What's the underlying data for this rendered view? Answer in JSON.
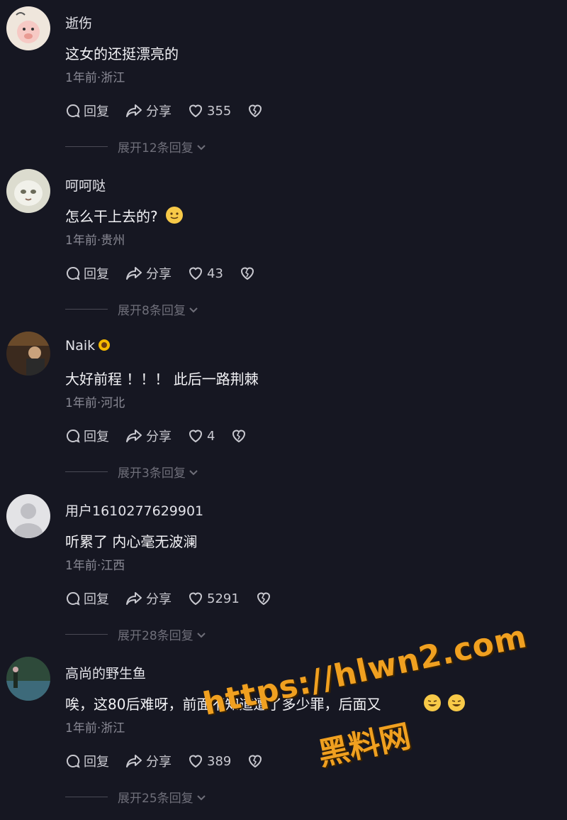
{
  "colors": {
    "background": "#161722",
    "text": "#e9e9ee",
    "muted": "#8a8a95",
    "watermark": "#f0a020"
  },
  "actions": {
    "reply": "回复",
    "share": "分享"
  },
  "comments": [
    {
      "username": "逝伤",
      "text": "这女的还挺漂亮的",
      "meta": "1年前·浙江",
      "likes": "355",
      "expand": "展开12条回复"
    },
    {
      "username": "呵呵哒",
      "text": "怎么干上去的?",
      "meta": "1年前·贵州",
      "likes": "43",
      "expand": "展开8条回复"
    },
    {
      "username": "Naik",
      "text": "大好前程 ！！！ 此后一路荆棘",
      "meta": "1年前·河北",
      "likes": "4",
      "expand": "展开3条回复"
    },
    {
      "username": "用户1610277629901",
      "text": "听累了 内心毫无波澜",
      "meta": "1年前·江西",
      "likes": "5291",
      "expand": "展开28条回复"
    },
    {
      "username": "高尚的野生鱼",
      "text": "唉，这80后难呀，前面不知道遭了多少罪，后面又",
      "meta": "1年前·浙江",
      "likes": "389",
      "expand": "展开25条回复"
    }
  ],
  "watermark": {
    "url": "https://hlwn2.com",
    "name": "黑料网"
  }
}
